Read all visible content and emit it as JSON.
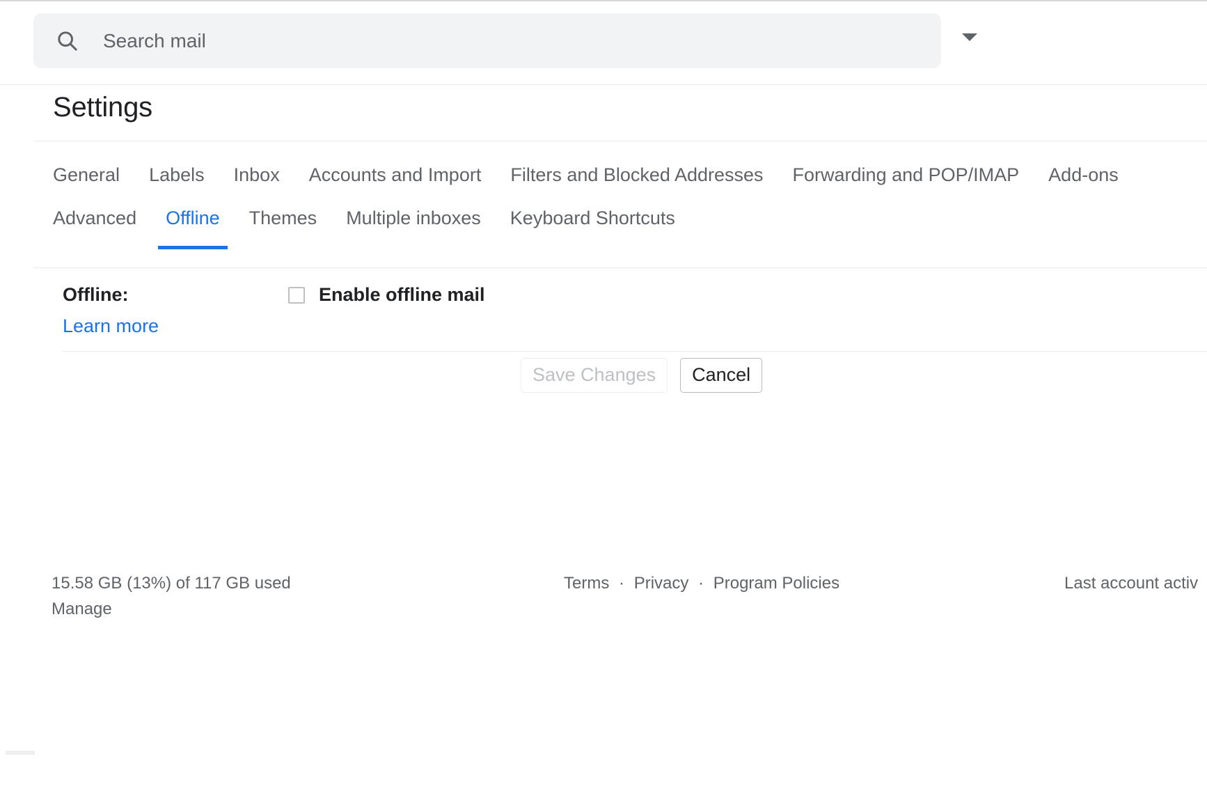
{
  "search": {
    "placeholder": "Search mail",
    "value": "",
    "icon": "search-icon",
    "options_icon": "chevron-down-icon"
  },
  "page_title": "Settings",
  "tabs": {
    "row1": [
      {
        "label": "General",
        "active": false
      },
      {
        "label": "Labels",
        "active": false
      },
      {
        "label": "Inbox",
        "active": false
      },
      {
        "label": "Accounts and Import",
        "active": false
      },
      {
        "label": "Filters and Blocked Addresses",
        "active": false
      },
      {
        "label": "Forwarding and POP/IMAP",
        "active": false
      },
      {
        "label": "Add-ons",
        "active": false
      }
    ],
    "row2": [
      {
        "label": "Advanced",
        "active": false
      },
      {
        "label": "Offline",
        "active": true
      },
      {
        "label": "Themes",
        "active": false
      },
      {
        "label": "Multiple inboxes",
        "active": false
      },
      {
        "label": "Keyboard Shortcuts",
        "active": false
      }
    ],
    "active_tab": "Offline",
    "accent_color": "#1a73e8"
  },
  "offline_section": {
    "label": "Offline:",
    "learn_more": "Learn more",
    "checkbox_label": "Enable offline mail",
    "checkbox_checked": false
  },
  "actions": {
    "save_label": "Save Changes",
    "save_disabled": true,
    "cancel_label": "Cancel"
  },
  "footer": {
    "storage_text": "15.58 GB (13%) of 117 GB used",
    "manage_label": "Manage",
    "links": {
      "terms": "Terms",
      "privacy": "Privacy",
      "program_policies": "Program Policies",
      "separator": "·"
    },
    "last_activity": "Last account activ"
  }
}
